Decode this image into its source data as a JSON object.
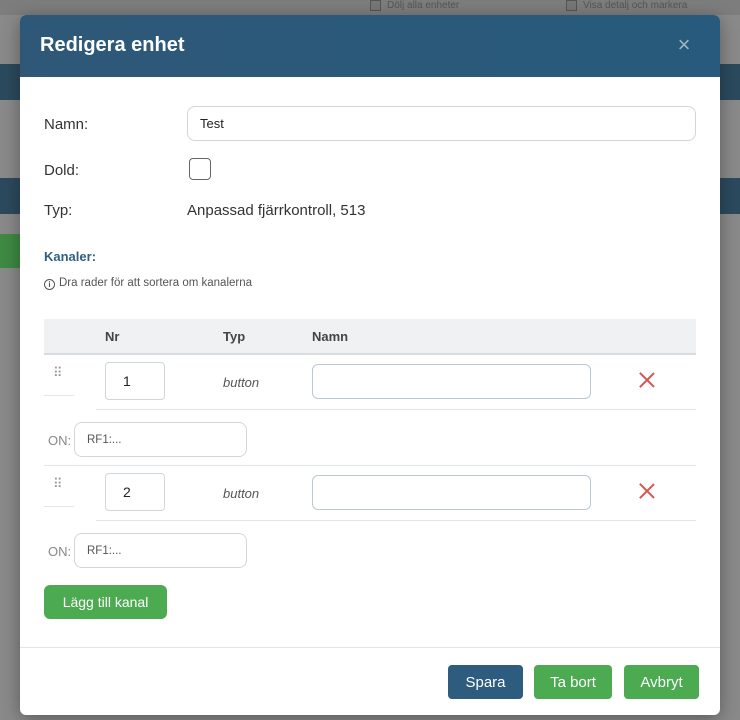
{
  "background": {
    "checkbox_1": "Dölj alla enheter",
    "checkbox_2": "Visa detalj och markera"
  },
  "modal": {
    "title": "Redigera enhet",
    "close_icon": "×"
  },
  "form": {
    "name_label": "Namn:",
    "name_value": "Test",
    "hidden_label": "Dold:",
    "hidden_checked": false,
    "type_label": "Typ:",
    "type_value": "Anpassad fjärrkontroll, 513"
  },
  "channels": {
    "heading": "Kanaler:",
    "hint": "Dra rader för att sortera om kanalerna",
    "columns": {
      "nr": "Nr",
      "type": "Typ",
      "name": "Namn"
    },
    "on_label": "ON:",
    "rows": [
      {
        "nr": "1",
        "type": "button",
        "name": "",
        "on_placeholder": "RF1:..."
      },
      {
        "nr": "2",
        "type": "button",
        "name": "",
        "on_placeholder": "RF1:..."
      }
    ],
    "add_label": "Lägg till kanal"
  },
  "footer": {
    "save_label": "Spara",
    "delete_label": "Ta bort",
    "cancel_label": "Avbryt"
  },
  "colors": {
    "header": "#2f5878",
    "primary": "#2d5c7f",
    "success": "#4caa50",
    "danger": "#d9534f",
    "accent_text": "#2f5f84"
  }
}
